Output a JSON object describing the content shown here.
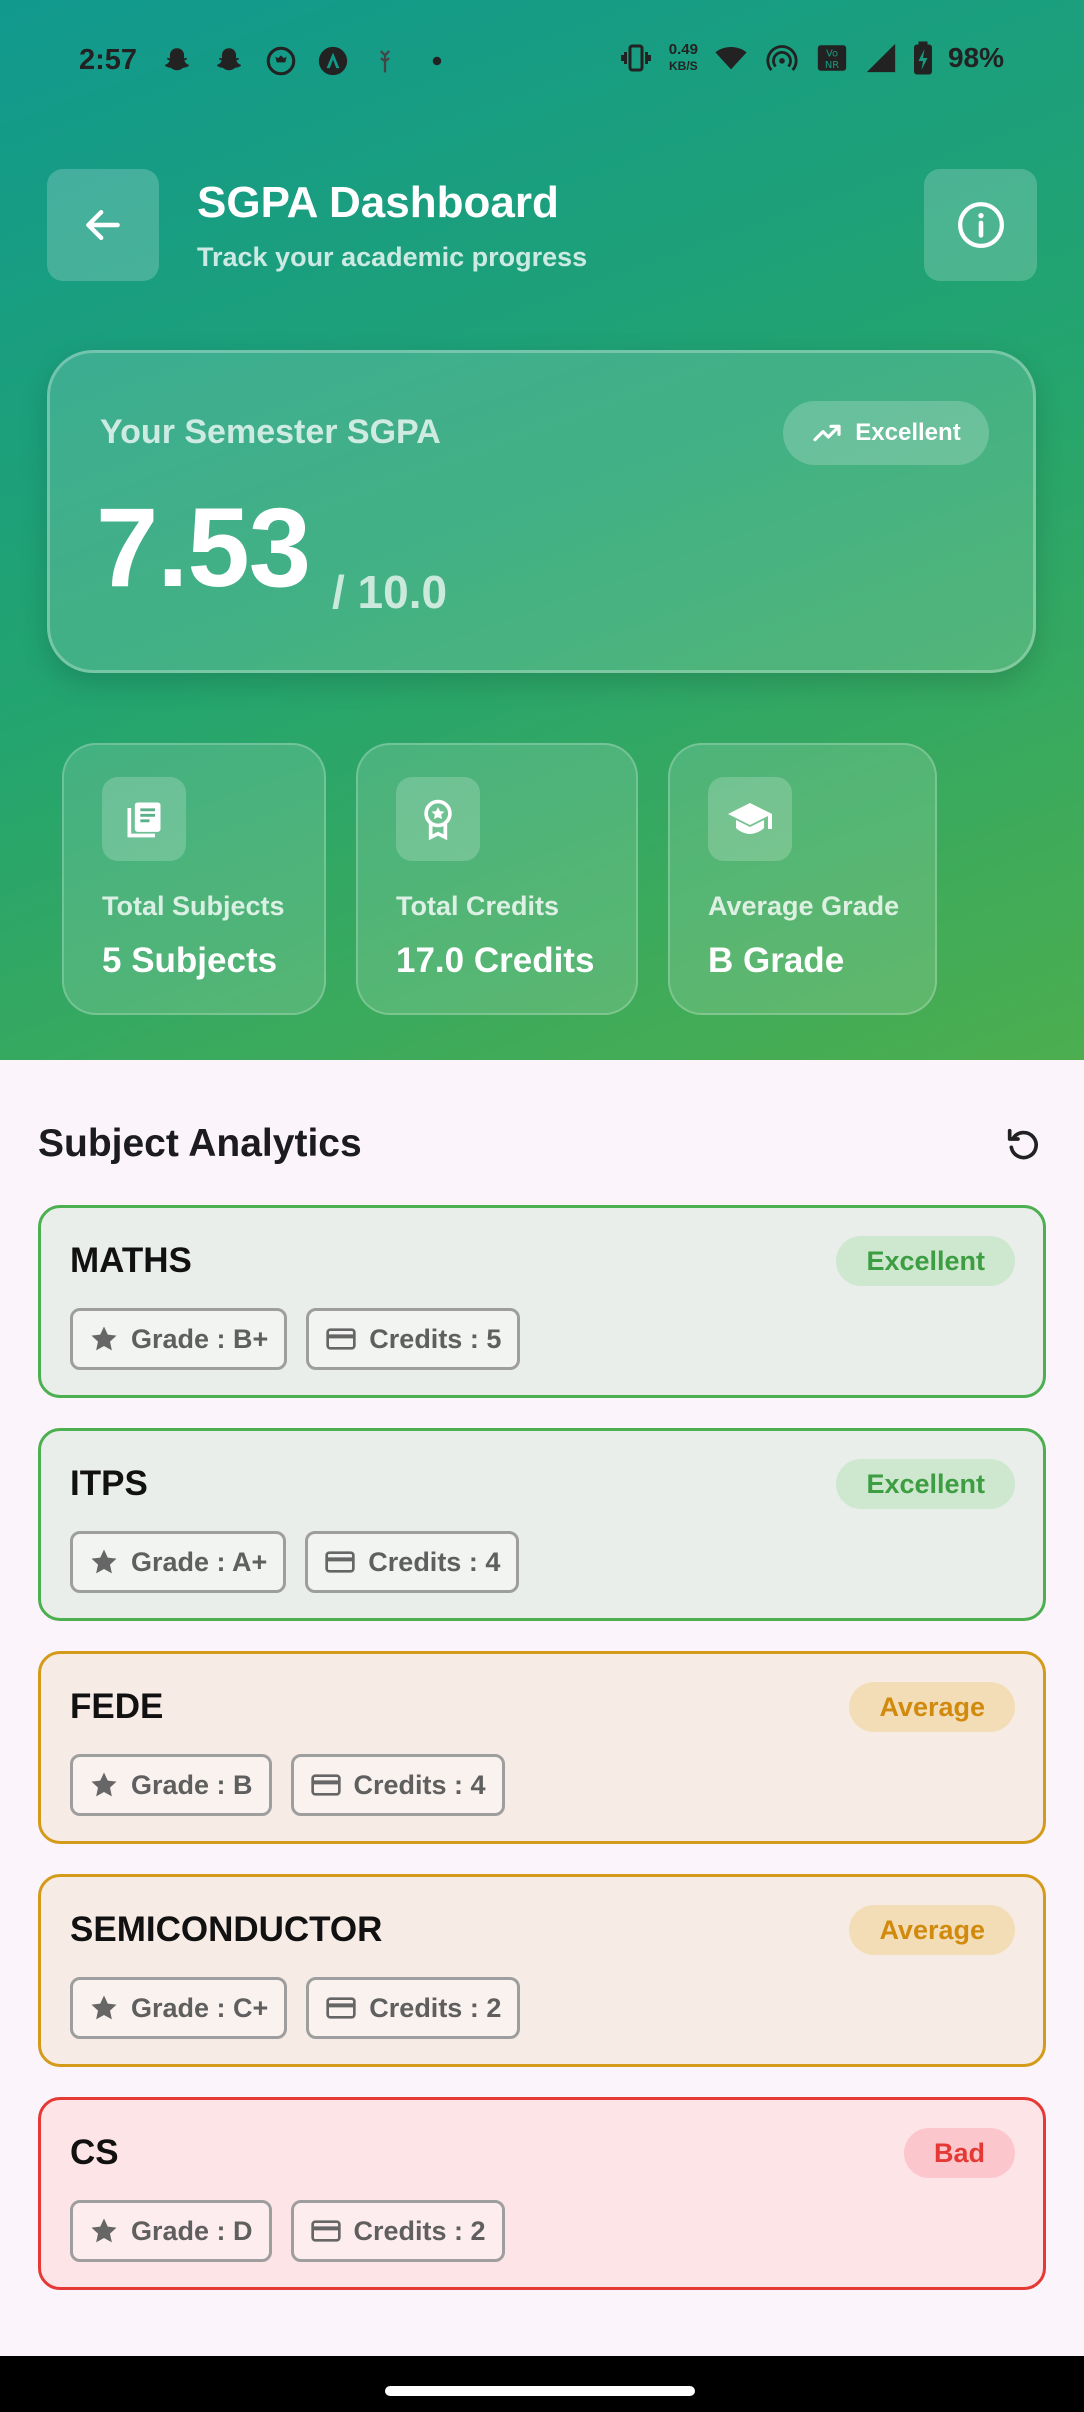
{
  "status_bar": {
    "time": "2:57",
    "net_speed_value": "0.49",
    "net_speed_unit": "KB/S",
    "volte_label": "Vo\nLTE",
    "battery": "98%"
  },
  "header": {
    "title": "SGPA Dashboard",
    "subtitle": "Track your academic progress"
  },
  "sgpa_card": {
    "label": "Your Semester SGPA",
    "value": "7.53",
    "max": "/ 10.0",
    "badge": "Excellent"
  },
  "stats": [
    {
      "label": "Total Subjects",
      "value": "5 Subjects",
      "icon": "book-icon"
    },
    {
      "label": "Total Credits",
      "value": "17.0 Credits",
      "icon": "award-icon"
    },
    {
      "label": "Average Grade",
      "value": "B Grade",
      "icon": "graduation-cap-icon"
    }
  ],
  "analytics": {
    "title": "Subject Analytics",
    "subjects": [
      {
        "name": "MATHS",
        "status": "Excellent",
        "grade": "Grade : B+",
        "credits": "Credits : 5"
      },
      {
        "name": "ITPS",
        "status": "Excellent",
        "grade": "Grade : A+",
        "credits": "Credits : 4"
      },
      {
        "name": "FEDE",
        "status": "Average",
        "grade": "Grade : B",
        "credits": "Credits : 4"
      },
      {
        "name": "SEMICONDUCTOR",
        "status": "Average",
        "grade": "Grade : C+",
        "credits": "Credits : 2"
      },
      {
        "name": "CS",
        "status": "Bad",
        "grade": "Grade : D",
        "credits": "Credits : 2"
      }
    ]
  },
  "colors": {
    "excellent": "#4caf50",
    "average": "#d49a1a",
    "bad": "#e53935",
    "header_gradient_start": "#11998e",
    "header_gradient_end": "#4cae4f"
  }
}
